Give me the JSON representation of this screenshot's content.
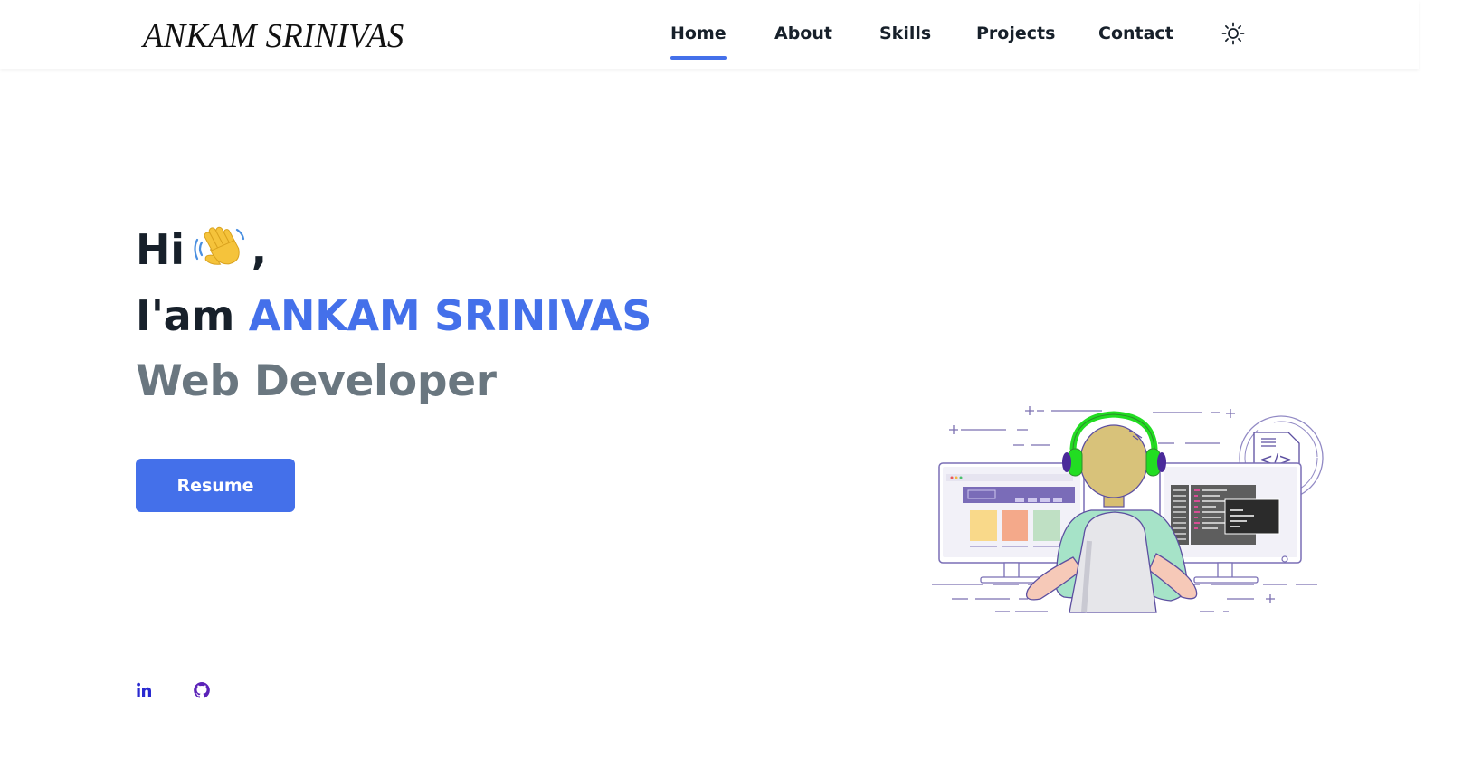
{
  "header": {
    "logo": "ANKAM SRINIVAS",
    "nav": [
      {
        "label": "Home",
        "active": true
      },
      {
        "label": "About",
        "active": false
      },
      {
        "label": "Skills",
        "active": false
      },
      {
        "label": "Projects",
        "active": false
      },
      {
        "label": "Contact",
        "active": false
      }
    ],
    "theme_icon": "sun-icon"
  },
  "hero": {
    "greeting": "Hi",
    "greeting_icon": "waving-hand-icon",
    "greeting_suffix": ",",
    "intro_prefix": "I'am",
    "name": "ANKAM SRINIVAS",
    "role": "Web Developer",
    "resume_label": "Resume"
  },
  "social": {
    "linkedin_icon": "linkedin-icon",
    "github_icon": "github-icon"
  },
  "colors": {
    "accent": "#4470ea",
    "heading": "#17202a",
    "muted": "#6a7780",
    "headphones": "#22dd22"
  }
}
